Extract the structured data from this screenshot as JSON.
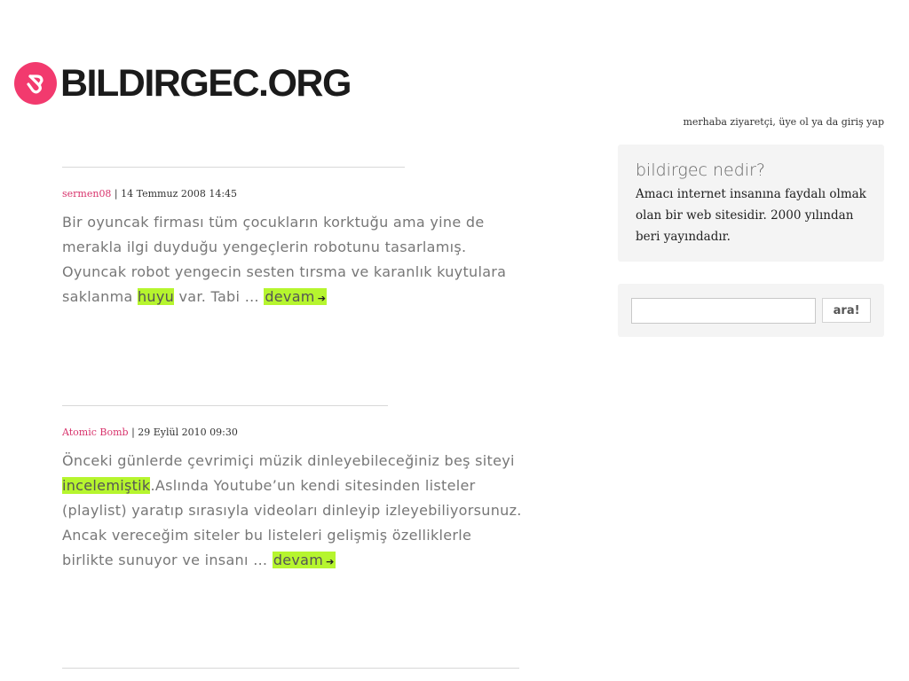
{
  "site": {
    "logo_text": "BILDIRGEC.ORG",
    "brand_color": "#f23a6e",
    "highlight_color": "#b6f52e"
  },
  "userbar": {
    "prefix": "merhaba ziyaretçi, ",
    "signup_label": "üye ol",
    "middle": " ya da ",
    "login_label": "giriş yap"
  },
  "posts": [
    {
      "author": "sermen08",
      "separator": " | ",
      "date": "14 Temmuz 2008 14:45",
      "excerpt_before": "Bir oyuncak firması tüm çocukların korktuğu ama yine de merakla ilgi duyduğu yengeçlerin robotunu tasarlamış. Oyuncak robot yengecin sesten tırsma ve karanlık kuytulara saklanma ",
      "highlight": "huyu",
      "excerpt_after": " var. Tabi … ",
      "more_label": "devam"
    },
    {
      "author": "Atomic Bomb",
      "separator": " | ",
      "date": "29 Eylül 2010 09:30",
      "excerpt_before": "Önceki günlerde çevrimiçi müzik dinleyebileceğiniz beş siteyi ",
      "highlight": "incelemiştik",
      "excerpt_after": ".Aslında Youtube’un kendi sitesinden listeler (playlist) yaratıp sırasıyla videoları dinleyip izleyebiliyorsunuz. Ancak vereceğim siteler bu listeleri gelişmiş özelliklerle birlikte sunuyor ve insanı … ",
      "more_label": "devam"
    }
  ],
  "sidebar": {
    "about": {
      "title": "bildirgec nedir?",
      "text": "Amacı internet insanına faydalı olmak olan bir web sitesidir. 2000 yılından beri yayındadır."
    },
    "search": {
      "value": "",
      "placeholder": "",
      "button_label": "ara!"
    }
  },
  "icons": {
    "logo": "heart-bird-logo-icon",
    "more_arrow": "arrow-right-icon"
  }
}
